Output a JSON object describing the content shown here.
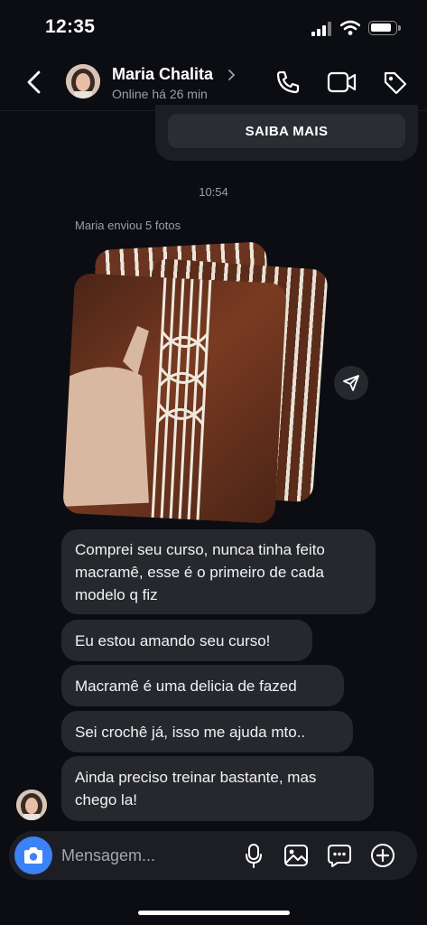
{
  "status_bar": {
    "time": "12:35"
  },
  "header": {
    "contact_name": "Maria Chalita",
    "contact_status": "Online há 26 min"
  },
  "previous_card": {
    "button_label": "SAIBA MAIS"
  },
  "thread": {
    "timestamp": "10:54",
    "photos_caption": "Maria enviou 5 fotos",
    "messages": [
      "Comprei seu curso, nunca tinha feito macramê, esse é o primeiro de cada modelo q fiz",
      "Eu estou amando seu curso!",
      "Macramê é uma delicia de fazed",
      "Sei crochê já, isso me ajuda mto..",
      "Ainda preciso treinar bastante, mas chego la!"
    ]
  },
  "composer": {
    "placeholder": "Mensagem..."
  },
  "icons": {
    "back": "chevron-left-icon",
    "call": "phone-icon",
    "video": "video-camera-icon",
    "tag": "tag-icon",
    "share": "paper-plane-icon",
    "camera": "camera-icon",
    "mic": "microphone-icon",
    "gallery": "image-icon",
    "sticker": "chat-bubble-icon",
    "add": "plus-circle-icon"
  },
  "colors": {
    "background": "#0b0d12",
    "bubble": "#26282e",
    "camera_button": "#3b82f6"
  }
}
